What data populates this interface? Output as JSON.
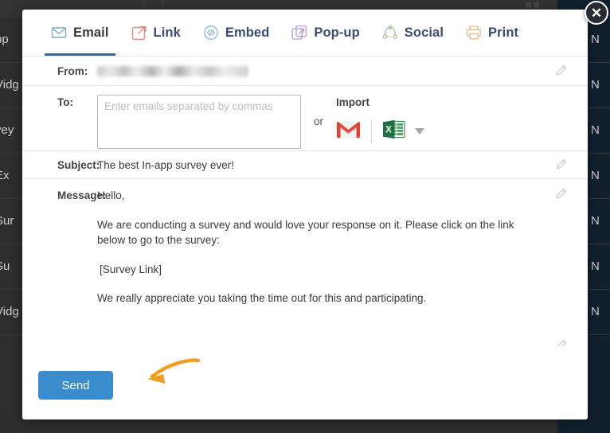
{
  "background": {
    "rows_left": [
      "pp",
      "Vidg",
      "vey",
      "Ex",
      "Sur",
      "Su",
      "Vidg"
    ],
    "rows_right": [
      "N",
      "N",
      "N",
      "N",
      "N",
      "N",
      "N"
    ],
    "grid_icon": "grid-icon",
    "accent_dark": "#2e2e2e",
    "panel_dark": "#12202e"
  },
  "modal": {
    "close_label": "✕",
    "tabs": [
      {
        "label": "Email",
        "icon": "envelope-icon",
        "active": true,
        "color": "#7fa8c4"
      },
      {
        "label": "Link",
        "icon": "external-link-icon",
        "active": false,
        "color": "#e28b84"
      },
      {
        "label": "Embed",
        "icon": "code-icon",
        "active": false,
        "color": "#8fb6d4"
      },
      {
        "label": "Pop-up",
        "icon": "popup-window-icon",
        "active": false,
        "color": "#b49bd8"
      },
      {
        "label": "Social",
        "icon": "share-nodes-icon",
        "active": false,
        "color": "#a9c99a"
      },
      {
        "label": "Print",
        "icon": "printer-icon",
        "active": false,
        "color": "#f0b98a"
      }
    ],
    "from": {
      "label": "From:",
      "value": "",
      "redacted": true,
      "edit_icon": "pencil-icon"
    },
    "to": {
      "label": "To:",
      "value": "",
      "placeholder": "Enter emails separated by commas"
    },
    "or_text": "or",
    "import": {
      "title": "Import",
      "gmail_icon": "gmail-icon",
      "excel_icon": "excel-icon",
      "caret_icon": "chevron-down-icon"
    },
    "subject": {
      "label": "Subject:",
      "value": "The best In-app survey ever!",
      "edit_icon": "pencil-icon"
    },
    "message": {
      "label": "Message:",
      "greeting": "Hello,",
      "paragraph1": "We are conducting a survey and would love your response on it. Please click on the link below to go to the survey:",
      "link_placeholder": "[Survey Link]",
      "paragraph2": "We really appreciate you taking the time out for this and participating.",
      "edit_icon": "pencil-icon"
    },
    "send_button": {
      "label": "Send",
      "color": "#3a8dcc"
    },
    "annotation_arrow": {
      "icon": "curved-arrow-annotation",
      "color": "#f39c1f"
    }
  }
}
